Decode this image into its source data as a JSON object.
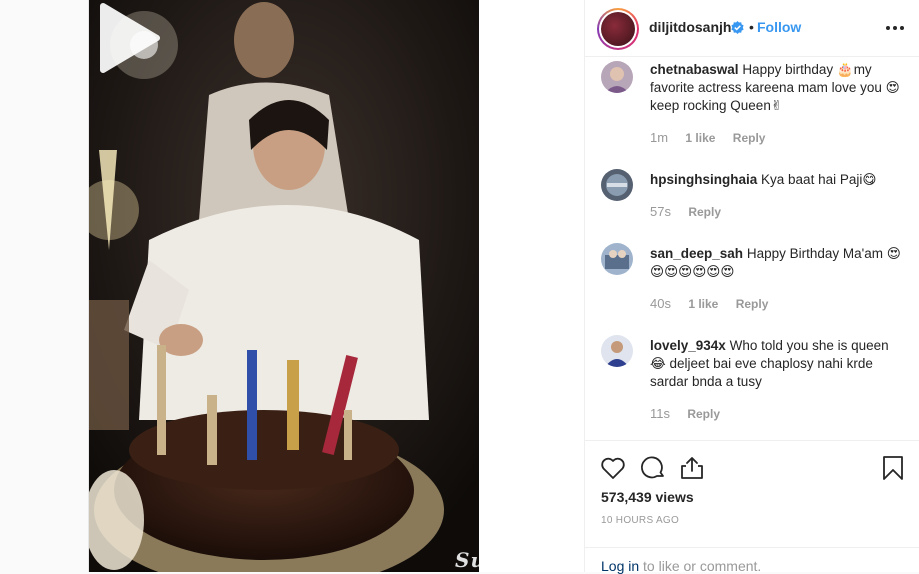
{
  "post": {
    "owner": {
      "username": "diljitdosanjh",
      "verified": true,
      "separator": "•",
      "follow_label": "Follow",
      "more_icon": "more-options-icon"
    },
    "media": {
      "type": "video",
      "watermark": "Suo..."
    },
    "comments": [
      {
        "username": "chetnabaswal",
        "text_parts": [
          "Happy birthday ",
          "🎂",
          "my favorite actress kareena mam love you ",
          "😍",
          "keep rocking Queen",
          "✌"
        ],
        "time": "1m",
        "likes": "1 like",
        "reply_label": "Reply"
      },
      {
        "username": "hpsinghsinghaia",
        "text_parts": [
          "Kya baat hai Paji",
          "😋"
        ],
        "time": "57s",
        "likes": "",
        "reply_label": "Reply"
      },
      {
        "username": "san_deep_sah",
        "text_parts": [
          "Happy Birthday Ma'am ",
          "😍😍😍😍😍😍😍"
        ],
        "time": "40s",
        "likes": "1 like",
        "reply_label": "Reply"
      },
      {
        "username": "lovely_934x",
        "text_parts": [
          "Who told you she is queen ",
          "😂",
          " deljeet bai eve chaplosy nahi krde sardar bnda a tusy"
        ],
        "time": "11s",
        "likes": "",
        "reply_label": "Reply"
      }
    ],
    "actions": {
      "like_icon": "heart-icon",
      "comment_icon": "comment-icon",
      "share_icon": "share-icon",
      "save_icon": "bookmark-icon"
    },
    "views": "573,439 views",
    "age": "10 HOURS AGO",
    "login": {
      "link_label": "Log in",
      "suffix": " to like or comment."
    }
  },
  "colors": {
    "accent": "#3897f0",
    "text": "#262626",
    "muted": "#999999",
    "border": "#efefef"
  }
}
